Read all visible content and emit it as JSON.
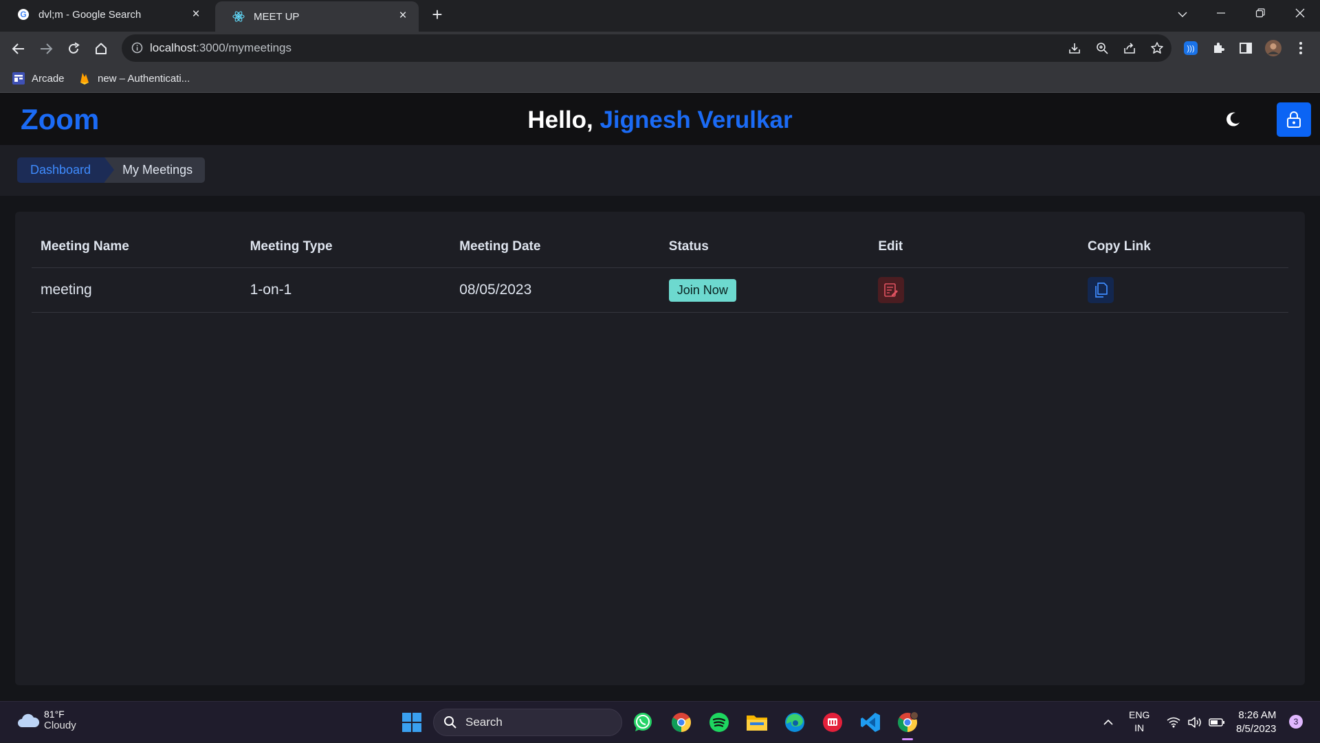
{
  "browser": {
    "tabs": [
      {
        "title": "dvl;m - Google Search"
      },
      {
        "title": "MEET UP"
      }
    ],
    "url_host": "localhost",
    "url_path": ":3000/mymeetings",
    "bookmarks": [
      {
        "label": "Arcade"
      },
      {
        "label": "new – Authenticati..."
      }
    ]
  },
  "app": {
    "brand": "Zoom",
    "greeting_prefix": "Hello, ",
    "user_name": "Jignesh Verulkar",
    "breadcrumb": {
      "parent": "Dashboard",
      "current": "My Meetings"
    },
    "table": {
      "headers": [
        "Meeting Name",
        "Meeting Type",
        "Meeting Date",
        "Status",
        "Edit",
        "Copy Link"
      ],
      "rows": [
        {
          "name": "meeting",
          "type": "1-on-1",
          "date": "08/05/2023",
          "status": "Join Now"
        }
      ]
    }
  },
  "taskbar": {
    "temperature": "81°F",
    "condition": "Cloudy",
    "search_label": "Search",
    "lang_top": "ENG",
    "lang_bottom": "IN",
    "time": "8:26 AM",
    "date": "8/5/2023",
    "notification_count": "3"
  },
  "colors": {
    "accent": "#1b6bf5",
    "status_join": "#6dd9cf",
    "edit_bg": "#4b1d21",
    "copy_bg": "#13274f"
  }
}
